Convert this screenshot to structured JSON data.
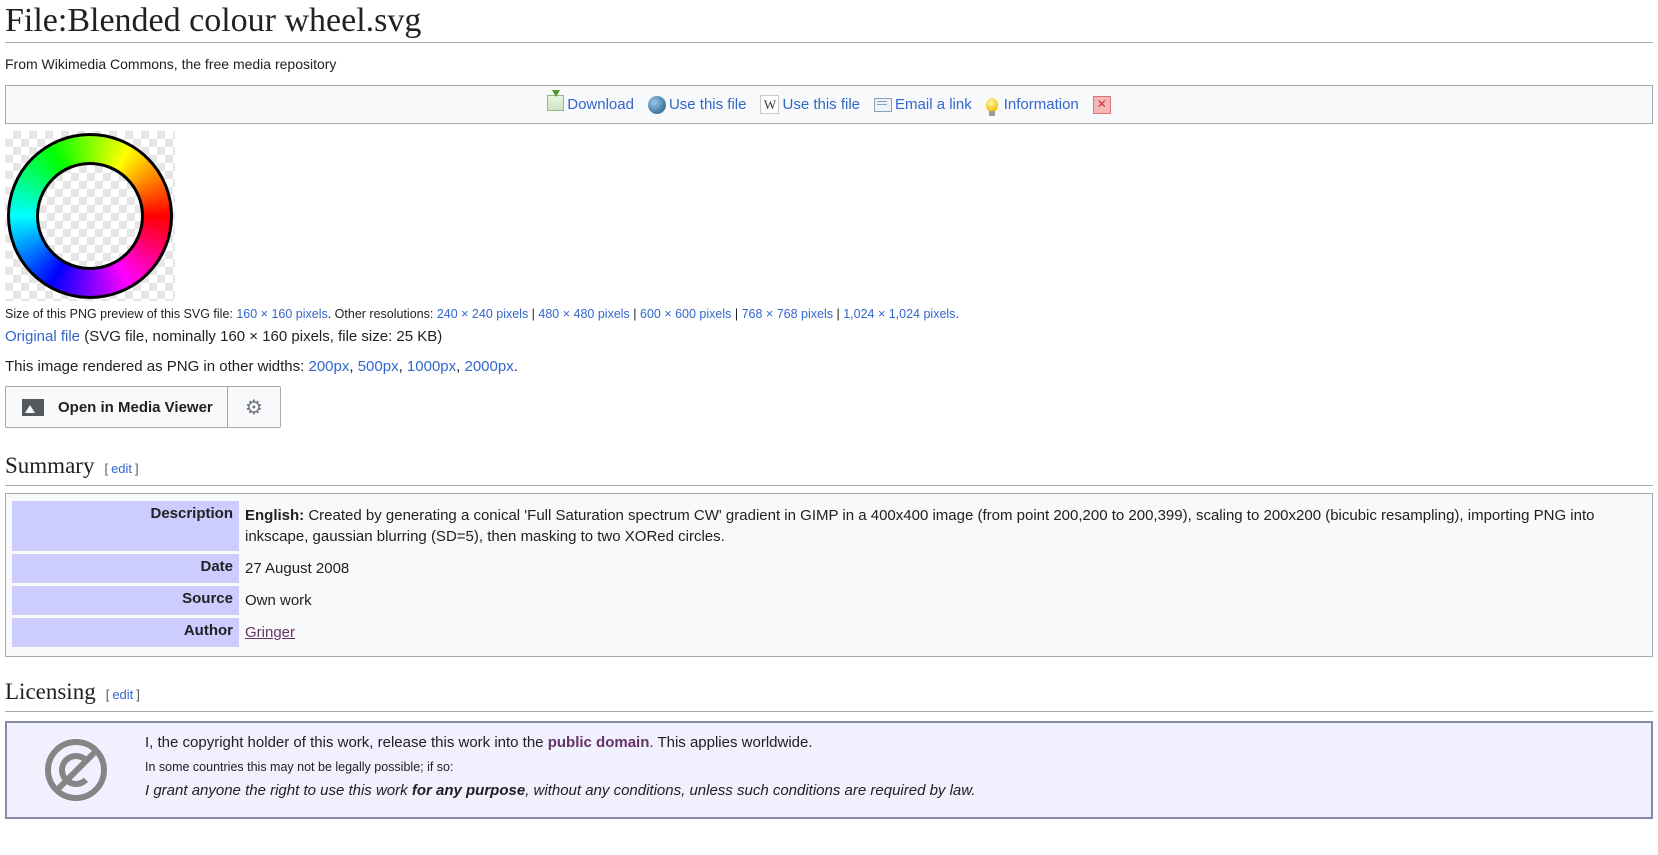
{
  "page": {
    "title": "File:Blended colour wheel.svg",
    "tagline": "From Wikimedia Commons, the free media repository"
  },
  "toolbar": {
    "items": [
      {
        "label": "Download",
        "icon": "download-icon"
      },
      {
        "label": "Use this file",
        "icon": "globe-icon"
      },
      {
        "label": "Use this file",
        "icon": "wikipedia-icon"
      },
      {
        "label": "Email a link",
        "icon": "email-icon"
      },
      {
        "label": "Information",
        "icon": "lightbulb-icon"
      }
    ],
    "close_glyph": "✕"
  },
  "file_info": {
    "size_prefix": "Size of this PNG preview of this SVG file: ",
    "size_current": "160 × 160 pixels",
    "other_prefix": ". Other resolutions: ",
    "res": [
      "240 × 240 pixels",
      "480 × 480 pixels",
      "600 × 600 pixels",
      "768 × 768 pixels",
      "1,024 × 1,024 pixels"
    ],
    "sep": " | ",
    "end": ".",
    "original_link": "Original file",
    "original_details": " (SVG file, nominally 160 × 160 pixels, file size: 25 KB)",
    "widths_prefix": "This image rendered as PNG in other widths: ",
    "widths": [
      "200px",
      "500px",
      "1000px",
      "2000px"
    ],
    "widths_sep": ", ",
    "widths_end": "."
  },
  "media_viewer": {
    "label": "Open in Media Viewer",
    "gear_glyph": "⚙"
  },
  "summary": {
    "heading": "Summary",
    "edit": "edit",
    "bracket_open": "[",
    "bracket_close": "]",
    "rows": {
      "description_label": "Description",
      "description_lang": "English:",
      "description_text": " Created by generating a conical 'Full Saturation spectrum CW' gradient in GIMP in a 400x400 image (from point 200,200 to 200,399), scaling to 200x200 (bicubic resampling), importing PNG into inkscape, gaussian blurring (SD=5), then masking to two XORed circles.",
      "date_label": "Date",
      "date_value": "27 August 2008",
      "source_label": "Source",
      "source_value": "Own work",
      "author_label": "Author",
      "author_value": "Gringer"
    }
  },
  "licensing": {
    "heading": "Licensing",
    "edit": "edit",
    "line1_a": "I, the copyright holder of this work, release this work into the ",
    "line1_link": "public domain",
    "line1_b": ". This applies worldwide.",
    "line2": "In some countries this may not be legally possible; if so:",
    "line3_a": "I grant anyone the right to use this work ",
    "line3_bold": "for any purpose",
    "line3_b": ", without any conditions, unless such conditions are required by law."
  },
  "colors": {
    "link": "#3366cc",
    "label_bg": "#ccccff",
    "license_bg": "#f0f0ff",
    "visited": "#663366"
  }
}
